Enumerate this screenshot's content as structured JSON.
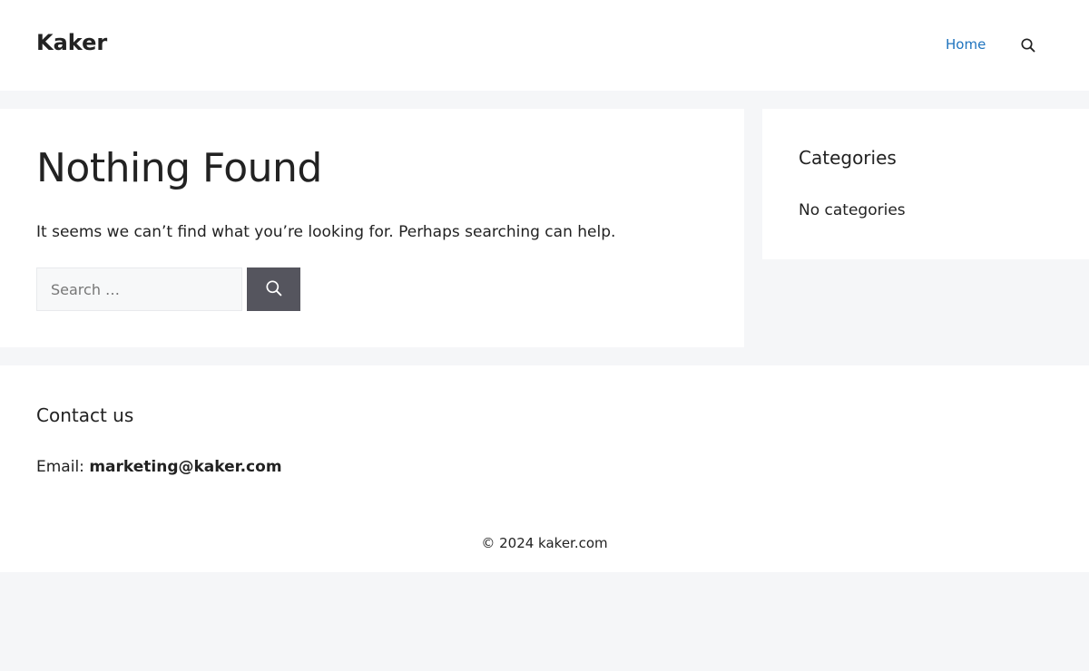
{
  "header": {
    "site_title": "Kaker",
    "nav": {
      "home_label": "Home",
      "search_icon": "search-icon"
    }
  },
  "main": {
    "title": "Nothing Found",
    "message": "It seems we can’t find what you’re looking for. Perhaps searching can help.",
    "search": {
      "placeholder": "Search …",
      "value": "",
      "button_icon": "search-icon"
    }
  },
  "sidebar": {
    "widget_title": "Categories",
    "widget_text": "No categories"
  },
  "footer": {
    "contact_title": "Contact us",
    "email_label": "Email:",
    "email_value": "marketing@kaker.com",
    "copyright": "© 2024 kaker.com"
  },
  "colors": {
    "page_background": "#f5f6f8",
    "panel_background": "#ffffff",
    "link_accent": "#1e73be",
    "search_button": "#55555e",
    "text": "#222222"
  }
}
